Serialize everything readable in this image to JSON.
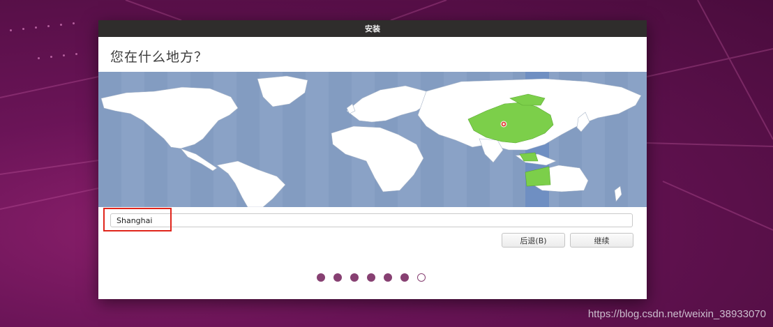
{
  "window": {
    "title": "安装"
  },
  "page": {
    "title": "您在什么地方？"
  },
  "map": {
    "ocean_color": "#8aa2c6",
    "land_color": "#ffffff",
    "selected_region_color": "#7ccf4a",
    "selected_timezone_band_color": "#6f8fc2",
    "marker_color": "#e04a3c",
    "selected_city": "Shanghai"
  },
  "location": {
    "value": "Shanghai"
  },
  "buttons": {
    "back": "后退(B)",
    "continue": "继续"
  },
  "progress": {
    "total_steps": 7,
    "current_step": 7
  },
  "watermark": "https://blog.csdn.net/weixin_38933070",
  "colors": {
    "accent": "#874072",
    "highlight_box": "#e0241b",
    "titlebar": "#2f2d2c"
  }
}
